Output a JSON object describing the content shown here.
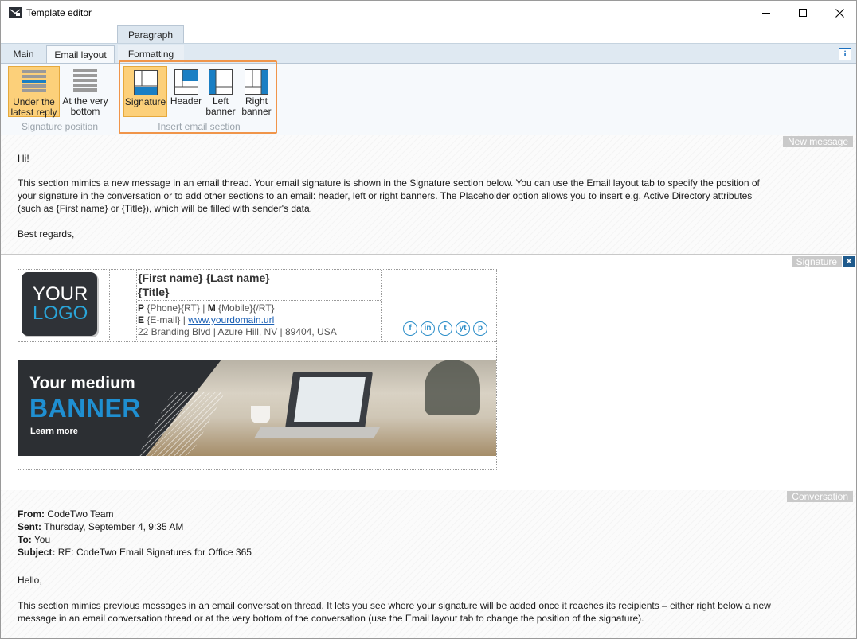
{
  "window": {
    "title": "Template editor"
  },
  "ribbon": {
    "context_tab": "Paragraph",
    "tabs": [
      {
        "label": "Main"
      },
      {
        "label": "Email layout"
      },
      {
        "label": "Formatting"
      }
    ],
    "active_tab": "Email layout",
    "info_label": "i",
    "groups": [
      {
        "label": "Signature position",
        "buttons": [
          {
            "line1": "Under the",
            "line2": "latest reply",
            "selected": true
          },
          {
            "line1": "At the very",
            "line2": "bottom",
            "selected": false
          }
        ]
      },
      {
        "label": "Insert email section",
        "buttons": [
          {
            "line1": "Signature",
            "line2": "",
            "selected": true
          },
          {
            "line1": "Header",
            "line2": "",
            "selected": false
          },
          {
            "line1": "Left",
            "line2": "banner",
            "selected": false
          },
          {
            "line1": "Right",
            "line2": "banner",
            "selected": false
          }
        ]
      }
    ]
  },
  "new_message": {
    "tag": "New message",
    "greeting": "Hi!",
    "body_line1": "This section mimics a new message in an email thread. Your email signature is shown in the Signature section below. You can use the Email layout tab to specify the position of",
    "body_line2": "your signature in the conversation or to add other sections to an email: header, left or right banners. The Placeholder option allows you to insert e.g. Active Directory attributes",
    "body_line3": "(such as {First name} or {Title}), which will be filled with sender's data.",
    "closing": "Best regards,"
  },
  "signature": {
    "tag": "Signature",
    "close_label": "✕",
    "logo_line1": "YOUR",
    "logo_line2": "LOGO",
    "name": "{First name} {Last name}",
    "title": "{Title}",
    "phone_label": "P",
    "phone_value": "{Phone}{RT}",
    "mobile_label": "M",
    "mobile_value": "{Mobile}{/RT}",
    "email_label": "E",
    "email_value": "{E-mail}",
    "website": "www.yourdomain.url",
    "address": "22 Branding Blvd | Azure Hill, NV | 89404, USA",
    "social": [
      "f",
      "in",
      "t",
      "yt",
      "p"
    ],
    "banner": {
      "line1": "Your medium",
      "line2": "BANNER",
      "cta": "Learn more"
    }
  },
  "conversation": {
    "tag": "Conversation",
    "from_label": "From:",
    "from_value": "CodeTwo Team",
    "sent_label": "Sent:",
    "sent_value": "Thursday, September 4, 9:35 AM",
    "to_label": "To:",
    "to_value": "You",
    "subject_label": "Subject:",
    "subject_value": "RE: CodeTwo Email Signatures for Office 365",
    "greeting": "Hello,",
    "body_line1": "This section mimics previous messages in an email conversation thread. It lets you see where your signature will be added once it reaches its recipients – either right below a new",
    "body_line2": "message in an email conversation thread or at the very bottom of the conversation (use the Email layout tab to change the position of the signature)."
  },
  "colors": {
    "accent_selected": "#fcd07a",
    "highlight_border": "#f0954a",
    "link": "#1a5fb4",
    "banner_blue": "#1f8fd1"
  }
}
